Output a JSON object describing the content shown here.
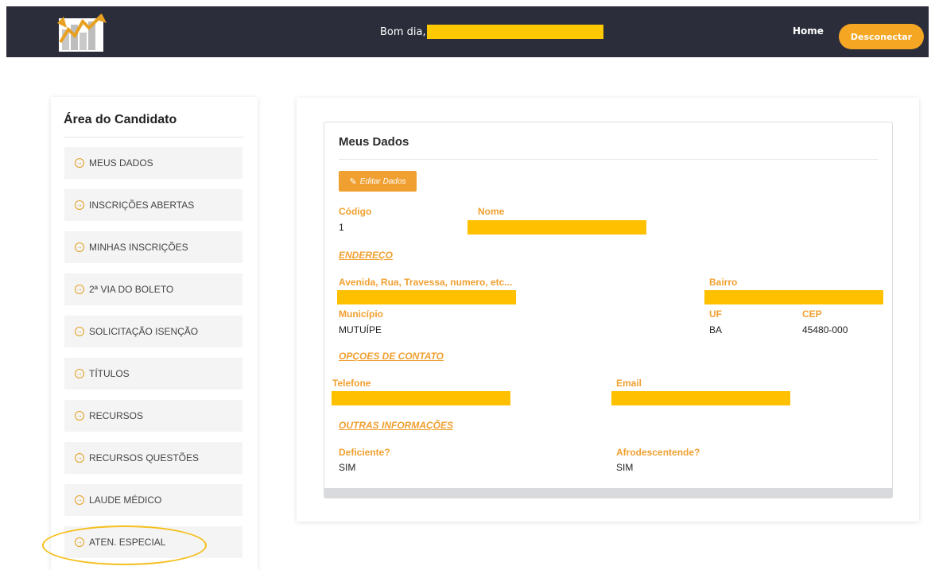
{
  "navbar": {
    "greeting": "Bom dia,",
    "home": "Home",
    "logout": "Desconectar"
  },
  "sidebar": {
    "title": "Área do Candidato",
    "items": [
      {
        "label": "MEUS DADOS"
      },
      {
        "label": "INSCRIÇÕES ABERTAS"
      },
      {
        "label": "MINHAS INSCRIÇÕES"
      },
      {
        "label": "2ª VIA DO BOLETO"
      },
      {
        "label": "SOLICITAÇÃO ISENÇÃO"
      },
      {
        "label": "TÍTULOS"
      },
      {
        "label": "RECURSOS"
      },
      {
        "label": "RECURSOS QUESTÕES"
      },
      {
        "label": "LAUDE MÉDICO"
      },
      {
        "label": "ATEN. ESPECIAL"
      }
    ]
  },
  "panel": {
    "title": "Meus Dados",
    "edit_button": "Editar Dados",
    "codigo_label": "Código",
    "codigo_value": "1",
    "nome_label": "Nome",
    "endereco_section": "ENDEREÇO",
    "rua_label": "Avenida, Rua, Travessa, numero, etc...",
    "bairro_label": "Bairro",
    "municipio_label": "Município",
    "municipio_value": "MUTUÍPE",
    "uf_label": "UF",
    "uf_value": "BA",
    "cep_label": "CEP",
    "cep_value": "45480-000",
    "contato_section": "OPÇOES DE CONTATO",
    "telefone_label": "Telefone",
    "email_label": "Email",
    "outras_section": "OUTRAS INFORMAÇÕES",
    "deficiente_label": "Deficiente?",
    "deficiente_value": "SIM",
    "afro_label": "Afrodescentende?",
    "afro_value": "SIM"
  },
  "colors": {
    "navbar_bg": "#2b2d3a",
    "accent": "#f0a030",
    "redaction": "#ffc000"
  }
}
